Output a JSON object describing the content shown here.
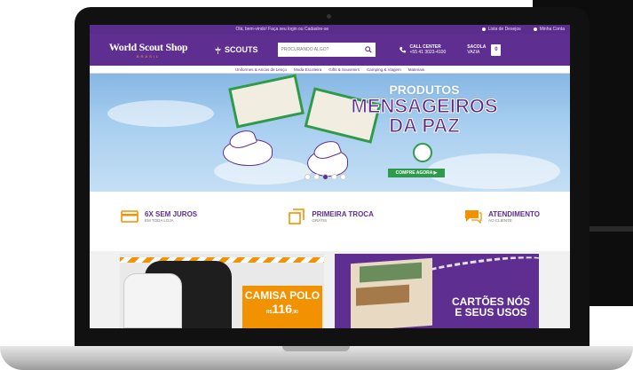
{
  "topbar": {
    "message": "Olá, bem-vindo! Faça seu login ou Cadastre-se",
    "link_account": "Lista de Desejos",
    "link_orders": "Minha Conta"
  },
  "header": {
    "logo_title": "World Scout Shop",
    "logo_sub": "BRASIL",
    "scouts_label": "SCOUTS",
    "search_placeholder": "PROCURANDO ALGO?",
    "call_title": "CALL CENTER",
    "call_number": "+55 41 3023-4100",
    "bag_title": "SACOLA",
    "bag_sub": "VAZIA",
    "bag_count": "0"
  },
  "nav": {
    "items": [
      "Uniformes & Ancas de Lenço",
      "Moda Escoteira",
      "Gifts & Souvenirs",
      "Camping & Viagem",
      "Materiais"
    ]
  },
  "hero": {
    "line1": "PRODUTOS",
    "line2": "MENSAGEIROS",
    "line3": "DA PAZ",
    "cta_label": "COMPRE AGORA ▶"
  },
  "benefits": [
    {
      "title": "6X SEM JUROS",
      "sub": "EM TODA LOJA"
    },
    {
      "title": "PRIMEIRA TROCA",
      "sub": "GRÁTIS"
    },
    {
      "title": "ATENDIMENTO",
      "sub": "AO CLIENTE"
    }
  ],
  "promos": {
    "left_title": "CAMISA POLO",
    "left_price_prefix": "R$",
    "left_price": "116",
    "left_cents": ",90",
    "right_line1": "CARTÕES NÓS",
    "right_line2": "E SEUS USOS"
  },
  "colors": {
    "brand_purple": "#5e2e91",
    "accent_orange": "#f39200",
    "accent_green": "#2f9a4c"
  }
}
